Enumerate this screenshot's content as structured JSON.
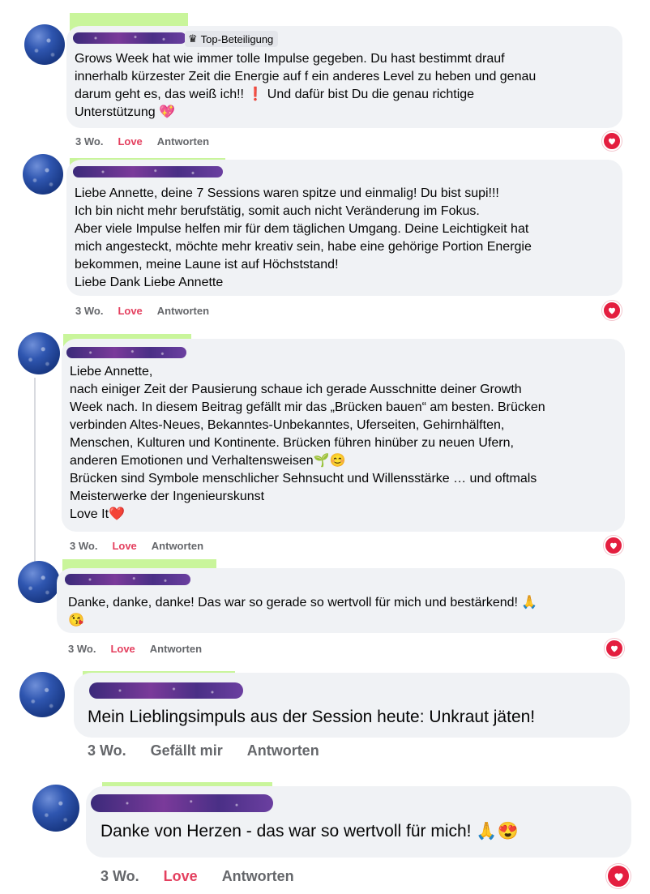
{
  "comments": [
    {
      "badge": "Top-Beteiligung",
      "text": "Grows Week hat wie immer tolle Impulse gegeben. Du hast bestimmt drauf\ninnerhalb kürzester Zeit die Energie auf f ein anderes Level zu heben und genau\ndarum geht es, das weiß ich!! ❗ Und dafür bist Du die genau richtige\nUnterstützung 💖",
      "time": "3 Wo.",
      "reaction": "Love",
      "reply": "Antworten"
    },
    {
      "text": "Liebe Annette, deine 7 Sessions waren spitze und einmalig! Du bist supi!!!\nIch bin nicht mehr berufstätig, somit auch nicht Veränderung im Fokus.\nAber viele Impulse helfen mir für dem täglichen Umgang. Deine Leichtigkeit hat\nmich angesteckt, möchte mehr kreativ sein, habe eine gehörige Portion Energie\nbekommen, meine Laune ist auf Höchststand!\nLiebe Dank Liebe Annette",
      "time": "3 Wo.",
      "reaction": "Love",
      "reply": "Antworten"
    },
    {
      "text": "Liebe Annette,\nnach einiger Zeit der Pausierung schaue ich gerade Ausschnitte deiner Growth\nWeek nach. In diesem Beitrag gefällt mir das „Brücken bauen“ am besten. Brücken\nverbinden Altes-Neues, Bekanntes-Unbekanntes, Uferseiten, Gehirnhälften,\nMenschen, Kulturen und Kontinente. Brücken führen hinüber zu neuen Ufern,\nanderen Emotionen und Verhaltensweisen🌱😊\nBrücken sind Symbole menschlicher Sehnsucht und Willensstärke … und oftmals\nMeisterwerke der Ingenieurskunst\nLove It❤️",
      "time": "3 Wo.",
      "reaction": "Love",
      "reply": "Antworten"
    },
    {
      "text": "Danke, danke, danke! Das war so gerade so wertvoll für mich und bestärkend! 🙏\n😘",
      "time": "3 Wo.",
      "reaction": "Love",
      "reply": "Antworten"
    },
    {
      "text": "Mein Lieblingsimpuls aus der Session heute: Unkraut jäten!",
      "time": "3 Wo.",
      "reaction": "Gefällt mir",
      "reply": "Antworten"
    },
    {
      "text": "Danke von Herzen - das war so wertvoll für mich! 🙏😍",
      "time": "3 Wo.",
      "reaction": "Love",
      "reply": "Antworten"
    }
  ],
  "icons": {
    "badge": "crown-icon",
    "reaction": "heart-icon"
  },
  "colors": {
    "bubble": "#f0f2f5",
    "love": "#e4405f",
    "highlight": "#c9f59b",
    "heart": "#e41e3f"
  }
}
